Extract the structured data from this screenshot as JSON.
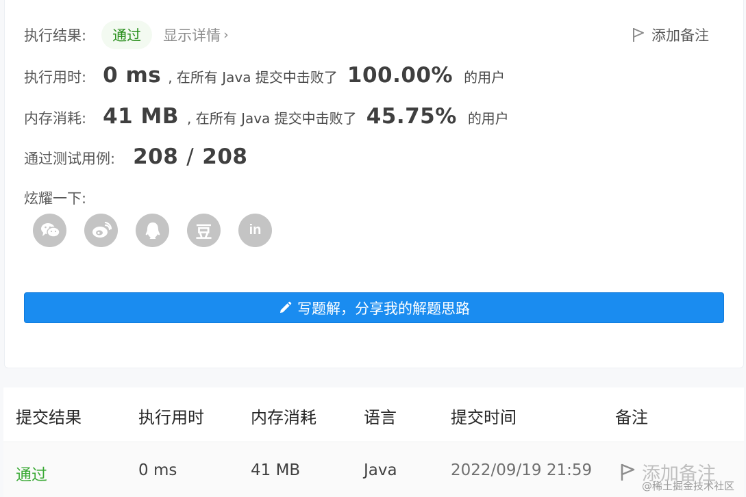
{
  "summary": {
    "result_label": "执行结果:",
    "result_value": "通过",
    "details_label": "显示详情",
    "add_note": "添加备注",
    "runtime": {
      "label": "执行用时:",
      "value": "0 ms",
      "mid": ", 在所有 Java 提交中击败了",
      "percent": "100.00%",
      "suffix": "的用户"
    },
    "memory": {
      "label": "内存消耗:",
      "value": "41 MB",
      "mid": ", 在所有 Java 提交中击败了",
      "percent": "45.75%",
      "suffix": "的用户"
    },
    "tests": {
      "label": "通过测试用例:",
      "passed": "208",
      "sep": "/",
      "total": "208"
    },
    "share_label": "炫耀一下:",
    "share_icons": [
      "wechat-icon",
      "weibo-icon",
      "qq-icon",
      "douban-icon",
      "linkedin-icon"
    ],
    "douban_glyph": "豆",
    "linkedin_glyph": "in",
    "write_solution": "写题解，分享我的解题思路"
  },
  "table": {
    "headers": [
      "提交结果",
      "执行用时",
      "内存消耗",
      "语言",
      "提交时间",
      "备注"
    ],
    "rows": [
      {
        "result": "通过",
        "runtime": "0 ms",
        "memory": "41 MB",
        "language": "Java",
        "time": "2022/09/19 21:59",
        "note": "添加备注"
      }
    ]
  },
  "watermark": "@稀土掘金技术社区",
  "colors": {
    "accent": "#1a8cf0",
    "success": "#3aa935",
    "icon_gray": "#c4c4c4"
  }
}
